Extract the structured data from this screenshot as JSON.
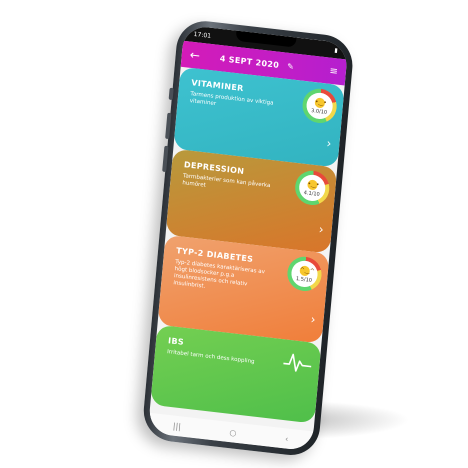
{
  "status": {
    "time": "17:01"
  },
  "header": {
    "date": "4 SEPT 2020",
    "back_icon": "arrow-left-icon",
    "edit_icon": "edit-icon",
    "menu_icon": "menu-icon"
  },
  "cards": [
    {
      "title": "VITAMINER",
      "desc": "Tarmens produktion av viktiga vitaminer",
      "score": "3.0/10",
      "rating": 3.0,
      "color": "#3ec2d0"
    },
    {
      "title": "DEPRESSION",
      "desc": "Tarmbakterier som kan påverka humöret",
      "score": "4.1/10",
      "rating": 4.1,
      "color": "#c8893a"
    },
    {
      "title": "TYP-2 DIABETES",
      "desc": "Typ-2 diabetes karaktäriseras av högt blodsocker p.g.a insulinresistens och relativ insulinbrist.",
      "score": "1.5/10",
      "rating": 1.5,
      "color": "#f08a4a"
    },
    {
      "title": "IBS",
      "desc": "Irritabel tarm och dess koppling",
      "color": "#5fc94e"
    }
  ],
  "nav": {
    "recent": "|||",
    "home": "○",
    "back": "‹"
  }
}
